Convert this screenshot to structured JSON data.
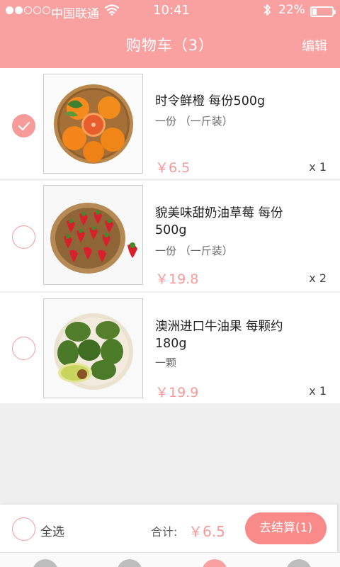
{
  "status_bar": {
    "carrier": "中国联通",
    "time": "10:41",
    "battery": "22%",
    "battery_level": 0.22,
    "signal_strength": 2,
    "signal_max": 5
  },
  "nav": {
    "title": "购物车（3）",
    "edit_label": "编辑"
  },
  "items": [
    {
      "name": "时令鲜橙 每份500g",
      "spec": "一份 （一斤装）",
      "price": "￥6.5",
      "quantity": "x 1",
      "checked": true,
      "image": "oranges-in-basket"
    },
    {
      "name": "貌美味甜奶油草莓 每份500g",
      "spec": "一份 （一斤装）",
      "price": "￥19.8",
      "quantity": "x 2",
      "checked": false,
      "image": "strawberries-in-basket"
    },
    {
      "name": "澳洲进口牛油果 每颗约180g",
      "spec": "一颗",
      "price": "￥19.9",
      "quantity": "x 1",
      "checked": false,
      "image": "avocados-in-basket"
    }
  ],
  "checkout": {
    "select_all_label": "全选",
    "total_label": "合计:",
    "total_value": "￥6.5",
    "checkout_button": "去结算(1)"
  },
  "colors": {
    "accent": "#f9a0a0",
    "price": "#f79a9a",
    "button": "#f98a8a",
    "background": "#efefef"
  },
  "tabbar": {
    "tabs": [
      "home-icon",
      "category-icon",
      "cart-icon",
      "profile-icon"
    ],
    "active_index": 2
  }
}
